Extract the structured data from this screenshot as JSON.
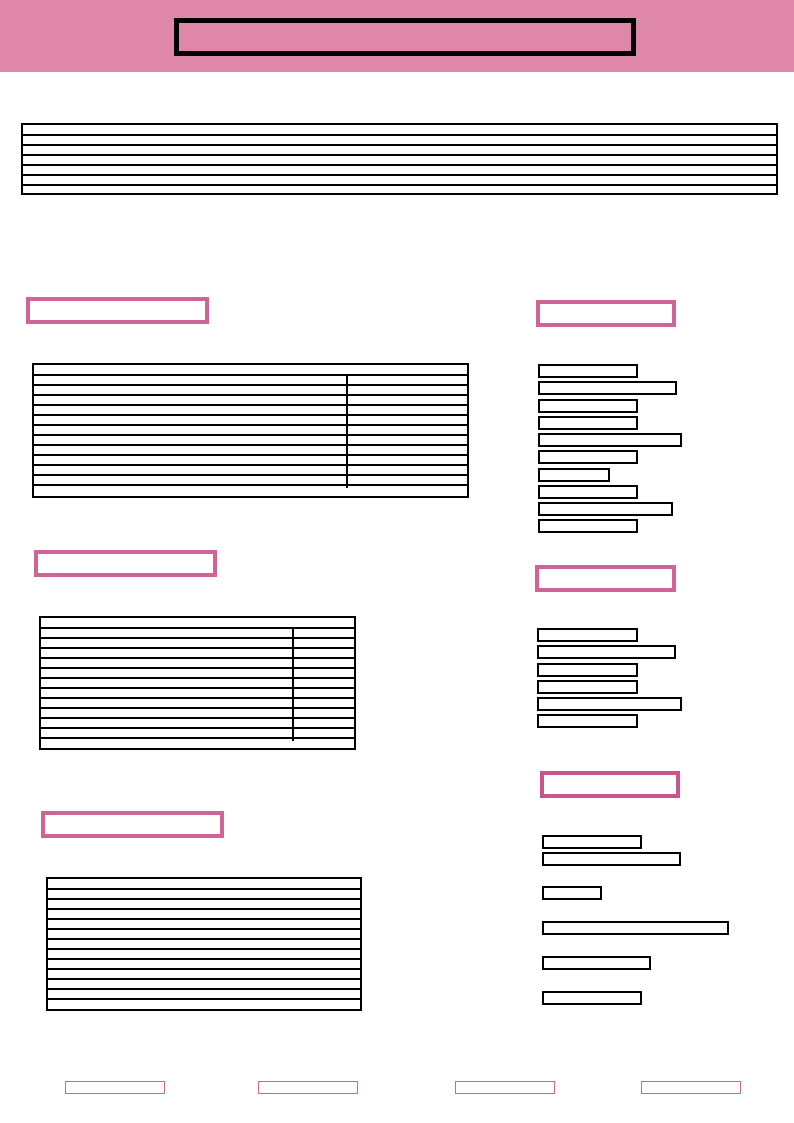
{
  "header": {
    "title": ""
  },
  "intro": {
    "lines": [
      "",
      "",
      "",
      "",
      "",
      "",
      ""
    ]
  },
  "sections": {
    "left1": {
      "title": "",
      "rows": [
        {
          "label": "",
          "value": ""
        },
        {
          "label": "",
          "value": ""
        },
        {
          "label": "",
          "value": ""
        },
        {
          "label": "",
          "value": ""
        },
        {
          "label": "",
          "value": ""
        },
        {
          "label": "",
          "value": ""
        },
        {
          "label": "",
          "value": ""
        },
        {
          "label": "",
          "value": ""
        },
        {
          "label": "",
          "value": ""
        },
        {
          "label": "",
          "value": ""
        },
        {
          "label": "",
          "value": ""
        },
        {
          "label": "",
          "value": ""
        }
      ]
    },
    "left2": {
      "title": "",
      "rows": [
        {
          "label": "",
          "value": ""
        },
        {
          "label": "",
          "value": ""
        },
        {
          "label": "",
          "value": ""
        },
        {
          "label": "",
          "value": ""
        },
        {
          "label": "",
          "value": ""
        },
        {
          "label": "",
          "value": ""
        },
        {
          "label": "",
          "value": ""
        },
        {
          "label": "",
          "value": ""
        },
        {
          "label": "",
          "value": ""
        },
        {
          "label": "",
          "value": ""
        },
        {
          "label": "",
          "value": ""
        },
        {
          "label": "",
          "value": ""
        },
        {
          "label": "",
          "value": ""
        }
      ]
    },
    "left3": {
      "title": "",
      "rows": [
        "",
        "",
        "",
        "",
        "",
        "",
        "",
        "",
        "",
        "",
        "",
        "",
        ""
      ]
    },
    "right1": {
      "title": "",
      "items": [
        "",
        "",
        "",
        "",
        "",
        "",
        "",
        "",
        "",
        ""
      ]
    },
    "right2": {
      "title": "",
      "items": [
        "",
        "",
        "",
        "",
        "",
        ""
      ]
    },
    "right3": {
      "title": "",
      "items": [
        "",
        "",
        "",
        "",
        "",
        ""
      ]
    }
  },
  "footer": {
    "items": [
      "",
      "",
      "",
      ""
    ]
  }
}
